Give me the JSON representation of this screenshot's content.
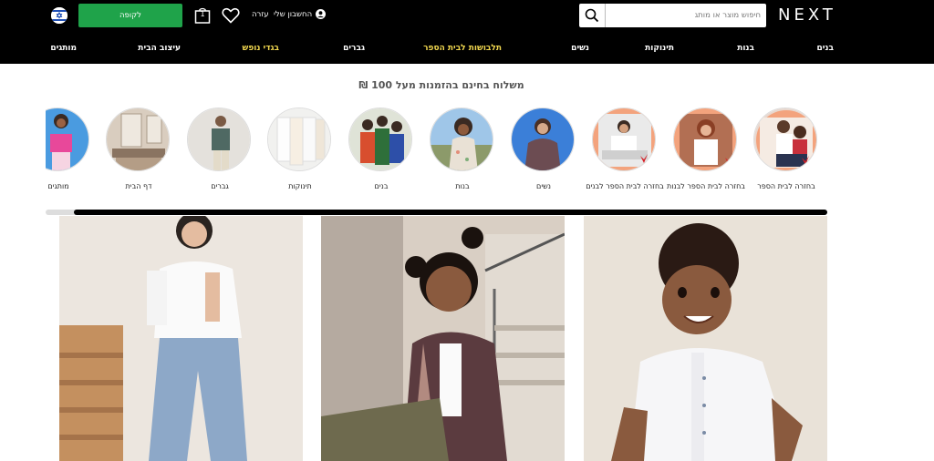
{
  "header": {
    "logo": "NEXT",
    "search_placeholder": "חיפוש מוצר או מותג",
    "account_label": "החשבון שלי",
    "help_label": "עזרה",
    "bag_count": "1",
    "checkout_label": "לקופה"
  },
  "nav": {
    "items": [
      {
        "label": "בנים"
      },
      {
        "label": "בנות"
      },
      {
        "label": "תינוקות"
      },
      {
        "label": "נשים"
      },
      {
        "label": "תלבושות לבית הספר"
      },
      {
        "label": "גברים"
      },
      {
        "label": "בגדי נופש"
      },
      {
        "label": "עיצוב הבית"
      },
      {
        "label": "מותגים"
      }
    ]
  },
  "promo": "משלוח בחינם בהזמנות מעל 100 ₪",
  "categories": [
    {
      "label": "בחזרה לבית הספר"
    },
    {
      "label": "בחזרה לבית הספר לבנות"
    },
    {
      "label": "בחזרה לבית הספר לבנים"
    },
    {
      "label": "נשים"
    },
    {
      "label": "בנות"
    },
    {
      "label": "בנים"
    },
    {
      "label": "תינוקות"
    },
    {
      "label": "גברים"
    },
    {
      "label": "דף הבית"
    },
    {
      "label": "מותגים"
    }
  ],
  "colors": {
    "header_bg": "#000000",
    "checkout_green": "#1fa34a",
    "nav_highlight": "#f1d74f"
  }
}
